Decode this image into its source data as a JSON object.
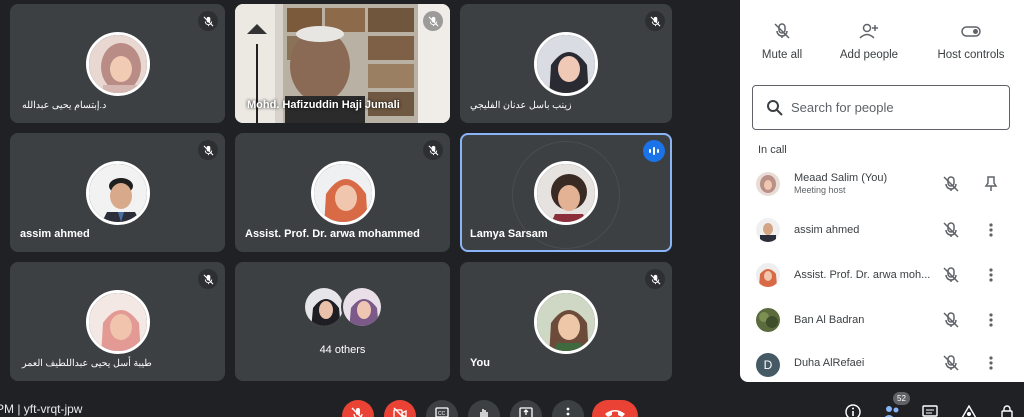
{
  "tiles": [
    {
      "name": "د.إبتسام يحيى عبدالله",
      "rtl": true,
      "muted": true
    },
    {
      "name": "Mohd. Hafizuddin Haji Jumali",
      "rtl": false,
      "muted": true,
      "video": true
    },
    {
      "name": "زينب باسل عدنان الفليجي",
      "rtl": true,
      "muted": true
    },
    {
      "name": "assim ahmed",
      "rtl": false,
      "muted": true
    },
    {
      "name": "Assist. Prof. Dr. arwa mohammed",
      "rtl": false,
      "muted": true
    },
    {
      "name": "Lamya Sarsam",
      "rtl": false,
      "speaking": true
    },
    {
      "name": "طيبة أسل يحيى عبداللطيف العمر",
      "rtl": true,
      "muted": true
    },
    {
      "name": "44 others"
    },
    {
      "name": "You",
      "rtl": false,
      "muted": true
    }
  ],
  "panel": {
    "mute_all": "Mute all",
    "add_people": "Add people",
    "host_controls": "Host controls",
    "search_placeholder": "Search for people",
    "in_call": "In call",
    "people": [
      {
        "name": "Meaad Salim (You)",
        "role": "Meeting host",
        "initial": ""
      },
      {
        "name": "assim ahmed",
        "role": "",
        "initial": ""
      },
      {
        "name": "Assist. Prof. Dr. arwa moh...",
        "role": "",
        "initial": ""
      },
      {
        "name": "Ban Al Badran",
        "role": "",
        "initial": ""
      },
      {
        "name": "Duha AlRefaei",
        "role": "",
        "initial": "D"
      }
    ]
  },
  "bar": {
    "meeting_code": "PM | yft-vrqt-jpw",
    "participants_count": "52"
  },
  "colors": {
    "background": "#202124",
    "tile": "#3c4043",
    "accent": "#1a73e8",
    "active_outline": "#8ab4f8",
    "danger": "#ea4335"
  },
  "icons": [
    "mic-off-icon",
    "cam-off-icon",
    "captions-icon",
    "hand-icon",
    "present-icon",
    "more-vert-icon",
    "end-call-icon",
    "info-icon",
    "people-icon",
    "chat-icon",
    "activities-icon",
    "lock-icon",
    "search-icon",
    "pin-icon",
    "add-person-icon",
    "toggle-icon",
    "speaking-icon"
  ]
}
